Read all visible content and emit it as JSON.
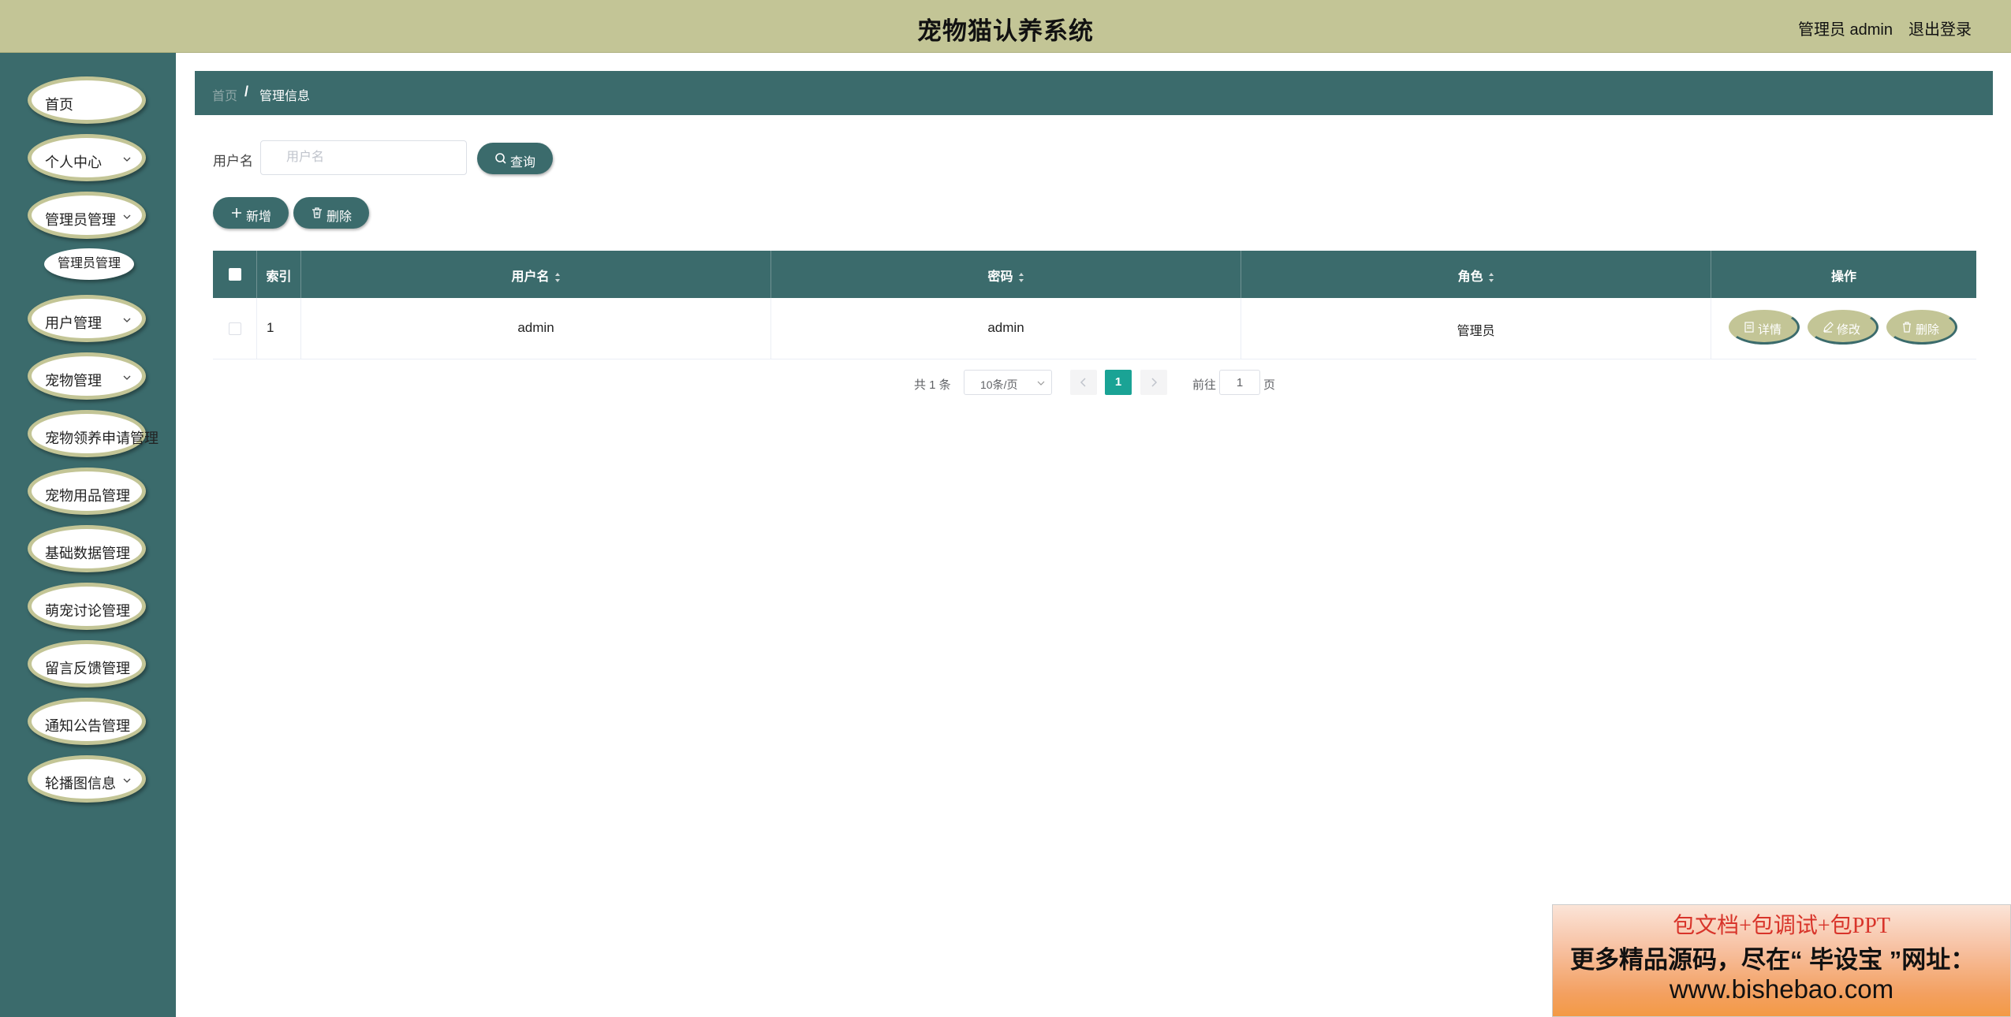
{
  "header": {
    "title": "宠物猫认养系统",
    "user": "管理员 admin",
    "logout": "退出登录"
  },
  "sidebar": {
    "items": [
      {
        "label": "首页"
      },
      {
        "label": "个人中心"
      },
      {
        "label": "管理员管理"
      },
      {
        "label": "用户管理"
      },
      {
        "label": "宠物管理"
      },
      {
        "label": "宠物领养申请管理"
      },
      {
        "label": "宠物用品管理"
      },
      {
        "label": "基础数据管理"
      },
      {
        "label": "萌宠讨论管理"
      },
      {
        "label": "留言反馈管理"
      },
      {
        "label": "通知公告管理"
      },
      {
        "label": "轮播图信息"
      }
    ],
    "submenu": {
      "label": "管理员管理"
    }
  },
  "breadcrumb": {
    "home": "首页",
    "separator": "/",
    "current": "管理信息"
  },
  "search": {
    "label": "用户名",
    "placeholder": "用户名",
    "button": "查询"
  },
  "actions": {
    "add": "新增",
    "delete": "删除"
  },
  "table": {
    "columns": {
      "index": "索引",
      "username": "用户名",
      "password": "密码",
      "role": "角色",
      "ops": "操作"
    },
    "rows": [
      {
        "index": "1",
        "username": "admin",
        "password": "admin",
        "role": "管理员"
      }
    ],
    "row_actions": {
      "detail": "详情",
      "edit": "修改",
      "delete": "删除"
    }
  },
  "pagination": {
    "total": "共 1 条",
    "page_size": "10条/页",
    "current_page": "1",
    "goto_label": "前往",
    "goto_value": "1",
    "page_suffix": "页"
  },
  "promo": {
    "line1": "包文档+包调试+包PPT",
    "line2": "更多精品源码，尽在“ 毕设宝 ”网址：",
    "line3": "www.bishebao.com"
  },
  "colors": {
    "header_bg": "#c3c596",
    "primary": "#3b6b6c",
    "active_page": "#1aa395"
  }
}
